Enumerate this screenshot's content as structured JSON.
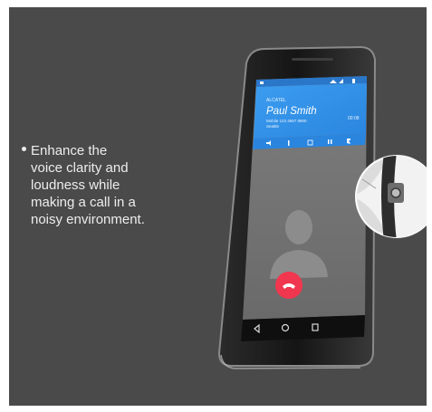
{
  "description_lines": [
    "Enhance the",
    "voice clarity and",
    "loudness while",
    "making a call in a",
    "noisy environment."
  ],
  "phone": {
    "screen": {
      "carrier": "ALCATEL",
      "caller_name": "Paul Smith",
      "caller_number": "Mobile 123 4567 8900",
      "caller_location": "Seattle",
      "call_timer": "00:08"
    }
  },
  "colors": {
    "background_panel": "#4a4a4a",
    "call_card": "#2f8fe6",
    "end_call_button": "#f0374f"
  },
  "icons": [
    "phone-icon",
    "wifi-icon",
    "signal-icon",
    "battery-icon",
    "speaker-icon",
    "bluetooth-icon",
    "dialpad-icon",
    "pause-icon",
    "add-call-icon",
    "contact-avatar-icon",
    "end-call-icon",
    "back-nav-icon",
    "home-nav-icon",
    "recents-nav-icon"
  ]
}
